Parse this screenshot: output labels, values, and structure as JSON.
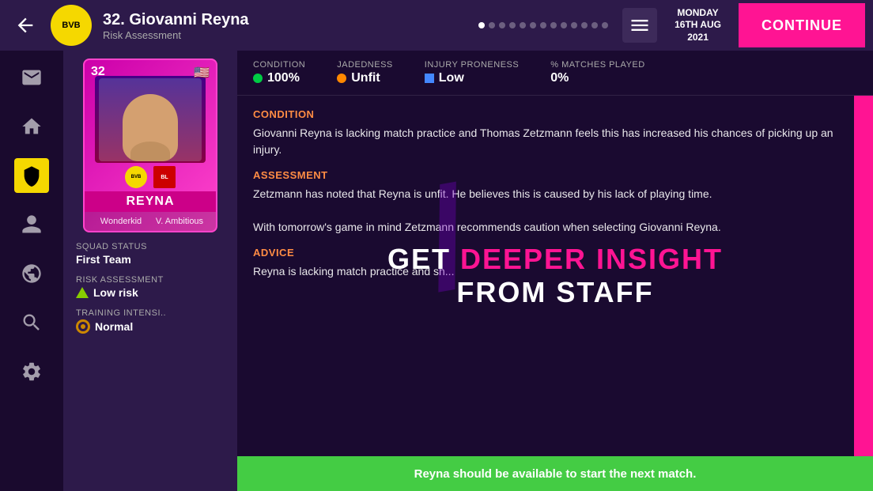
{
  "header": {
    "back_label": "back",
    "player_number": "32.",
    "player_name": "Giovanni Reyna",
    "subtitle": "Risk Assessment",
    "date_line1": "MONDAY",
    "date_line2": "16TH AUG",
    "date_line3": "2021",
    "continue_label": "CONTINUE",
    "club_initials": "BVB"
  },
  "dots": [
    1,
    2,
    3,
    4,
    5,
    6,
    7,
    8,
    9,
    10,
    11,
    12,
    13
  ],
  "active_dot": 0,
  "stats": {
    "condition_label": "CONDITION",
    "condition_value": "100%",
    "jadedness_label": "JADEDNESS",
    "jadedness_value": "Unfit",
    "injury_label": "INJURY PRONENESS",
    "injury_value": "Low",
    "matches_label": "% MATCHES PLAYED",
    "matches_value": "0%"
  },
  "card": {
    "number": "32",
    "flag": "🇺🇸",
    "name": "REYNA",
    "attr1": "Wonderkid",
    "attr2": "V. Ambitious",
    "club_initials": "BVB"
  },
  "squad_info": {
    "squad_status_label": "SQUAD STATUS",
    "squad_status_value": "First Team",
    "risk_label": "RISK ASSESSMENT",
    "risk_value": "Low risk",
    "training_label": "TRAINING INTENSI..",
    "training_value": "Normal"
  },
  "sections": {
    "condition": {
      "title": "CONDITION",
      "text": "Giovanni Reyna is lacking match practice and Thomas Zetzmann feels this has increased his chances of picking up an injury."
    },
    "assessment": {
      "title": "ASSESSMENT",
      "text": "Zetzmann has noted that Reyna is unfit. He believes this is caused by his lack of playing time.\n\nWith tomorrow's game in mind Zetzmann recommends caution when selecting Giovanni Reyna."
    },
    "advice": {
      "title": "ADVICE",
      "text": "Reyna is lacking match practice and sh..."
    }
  },
  "promo": {
    "line1_get": "GET ",
    "line1_deep": "DEEPER INSIGHT",
    "line2": "FROM STAFF",
    "slash": "/"
  },
  "bottom_bar": {
    "text": "Reyna should be available to start the next match."
  }
}
